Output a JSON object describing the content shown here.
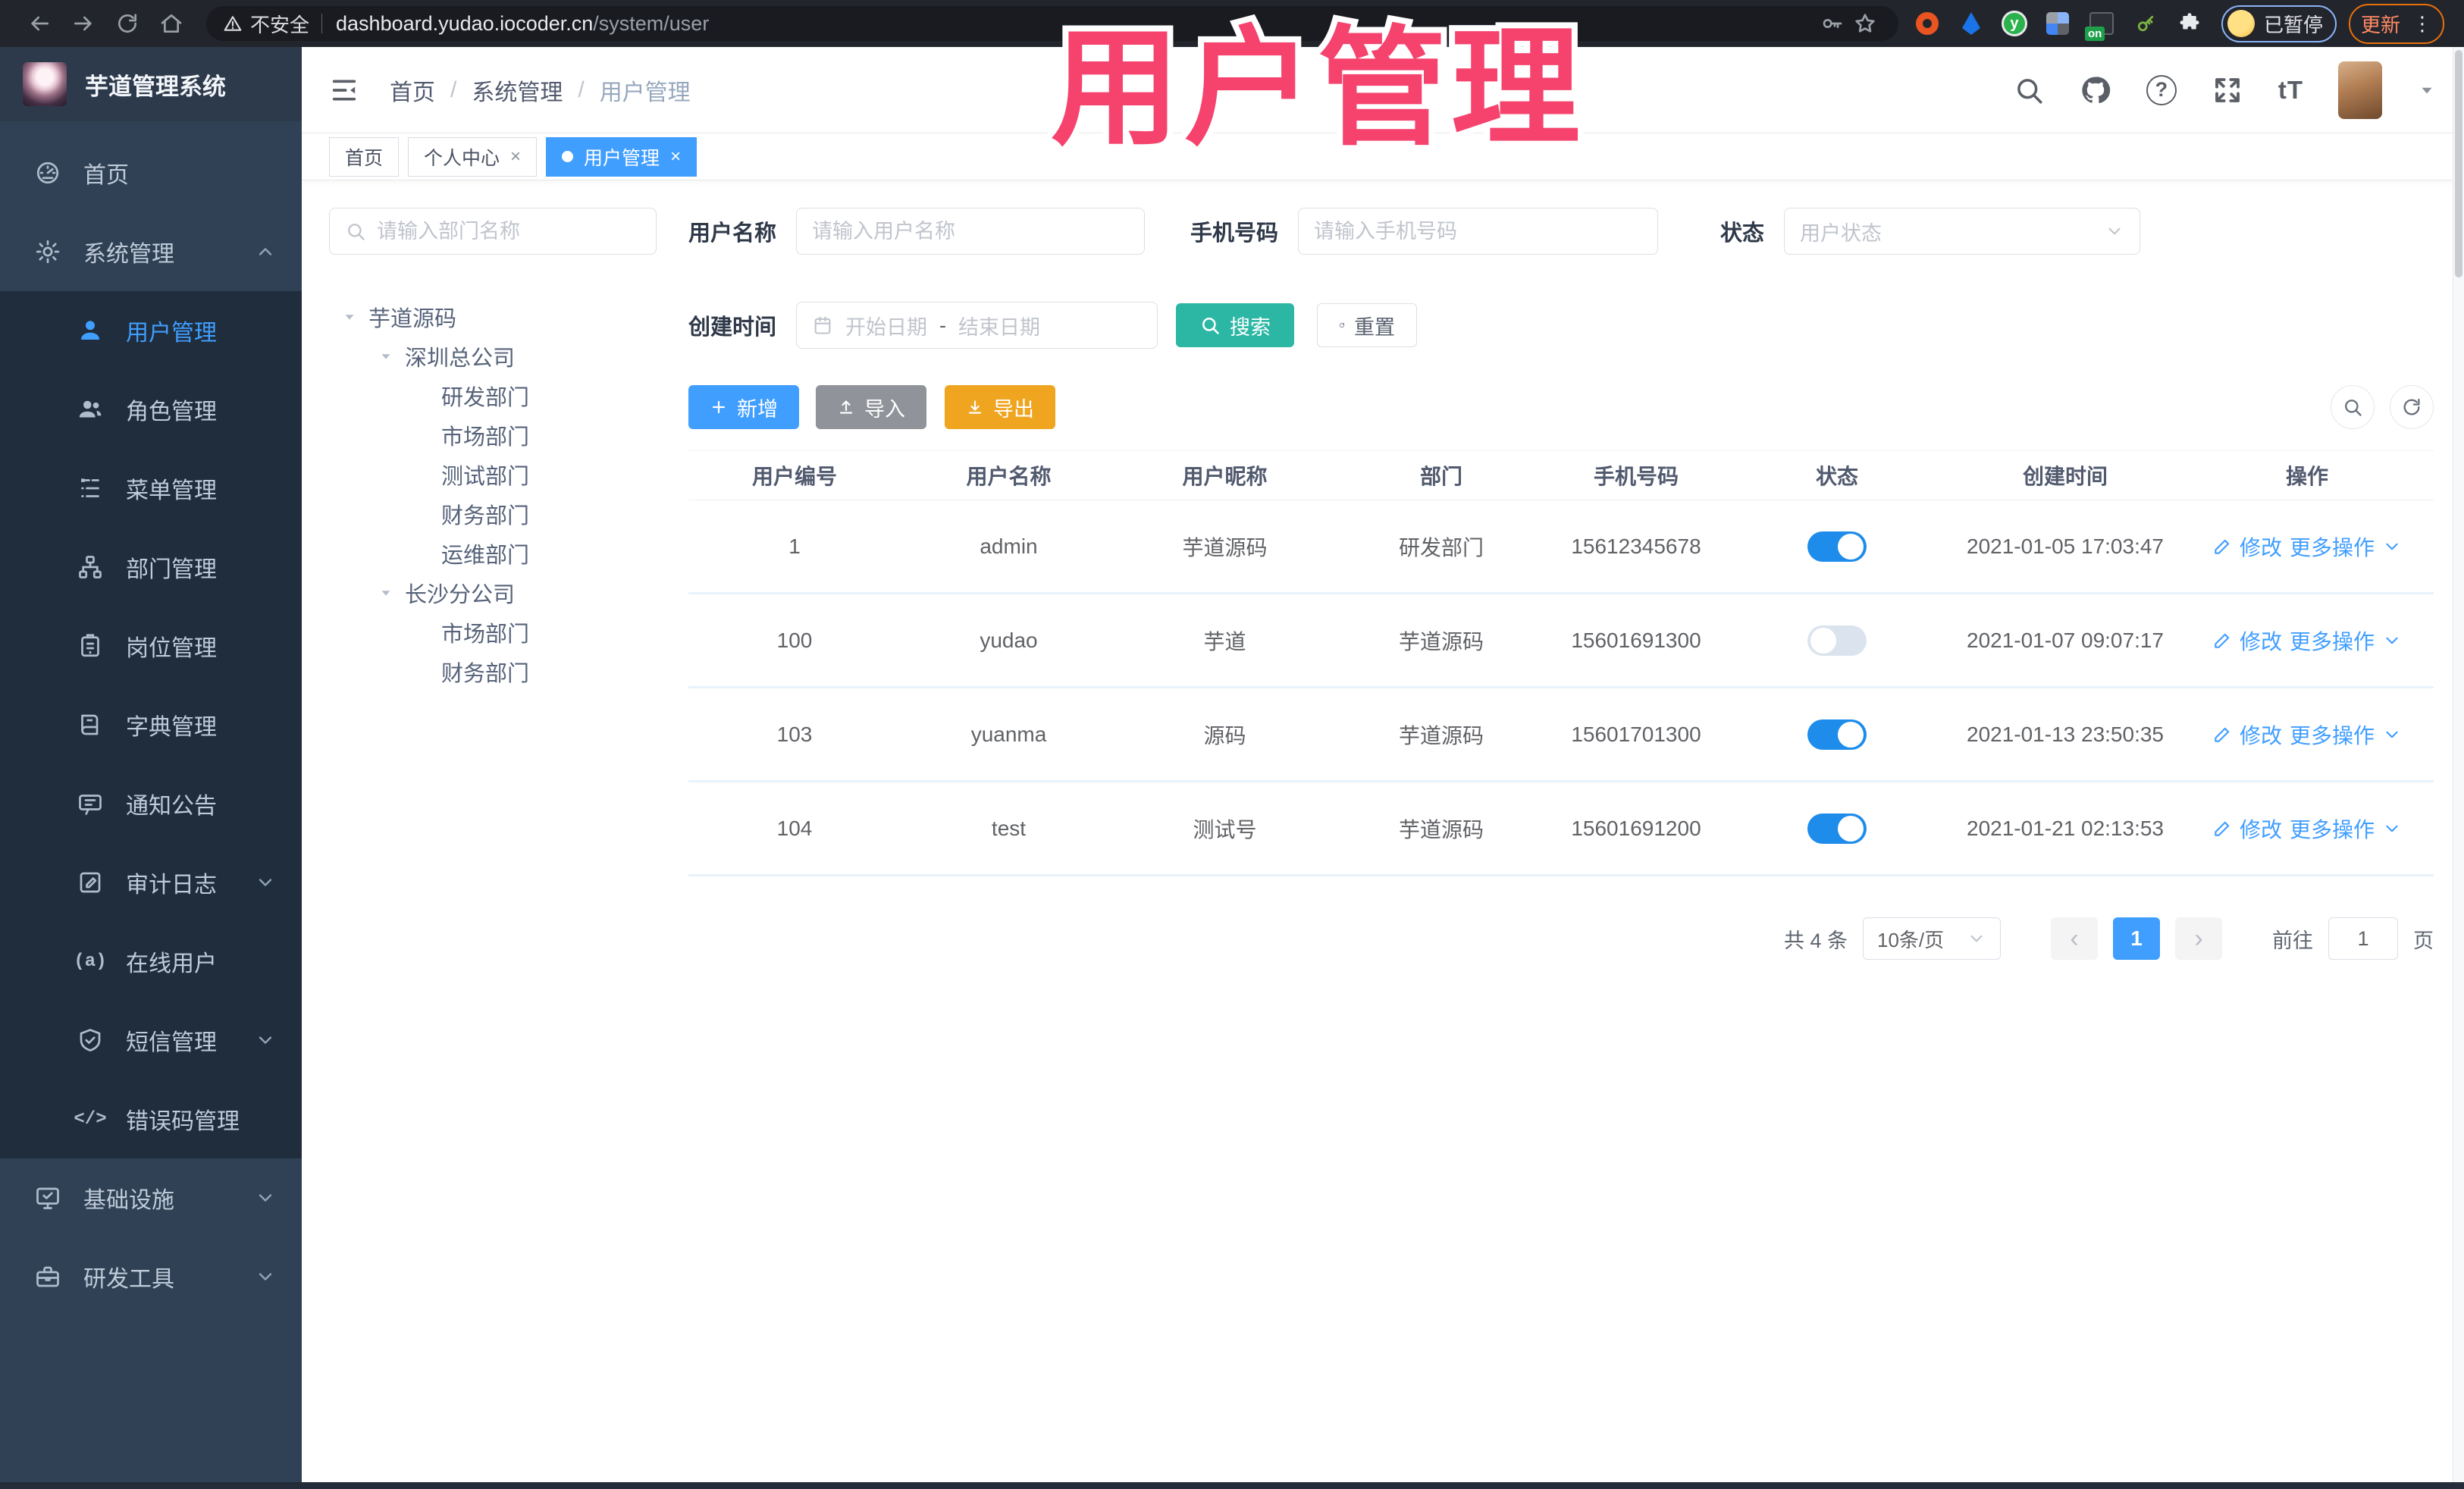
{
  "overlay": {
    "title": "用户管理"
  },
  "colors": {
    "primary": "#409eff",
    "search_teal": "#2cb7a4",
    "export_orange": "#efa51f",
    "import_gray": "#909399",
    "sidebar_bg": "#304156",
    "submenu_bg": "#1f2d3d",
    "overlay_pink": "#f5436d"
  },
  "icons": {
    "slash": "/",
    "close": "×",
    "prev": "‹",
    "next": "›",
    "question": "?",
    "font_size": "tT",
    "online": "(a)",
    "code": "</>",
    "ellipsis": "⋮",
    "y_badge": "y",
    "on_badge": "on"
  },
  "browser": {
    "security_label": "不安全",
    "url_host": "dashboard.yudao.iocoder.cn",
    "url_path": "/system/user",
    "paused_label": "已暂停",
    "update_label": "更新"
  },
  "sidebar": {
    "app_title": "芋道管理系统",
    "items": [
      {
        "label": "首页"
      },
      {
        "label": "系统管理"
      },
      {
        "label": "用户管理"
      },
      {
        "label": "角色管理"
      },
      {
        "label": "菜单管理"
      },
      {
        "label": "部门管理"
      },
      {
        "label": "岗位管理"
      },
      {
        "label": "字典管理"
      },
      {
        "label": "通知公告"
      },
      {
        "label": "审计日志"
      },
      {
        "label": "在线用户"
      },
      {
        "label": "短信管理"
      },
      {
        "label": "错误码管理"
      },
      {
        "label": "基础设施"
      },
      {
        "label": "研发工具"
      }
    ]
  },
  "breadcrumb": {
    "items": [
      "首页",
      "系统管理",
      "用户管理"
    ]
  },
  "tabs": [
    {
      "label": "首页"
    },
    {
      "label": "个人中心"
    },
    {
      "label": "用户管理"
    }
  ],
  "dept": {
    "search_placeholder": "请输入部门名称",
    "tree": [
      {
        "label": "芋道源码"
      },
      {
        "label": "深圳总公司"
      },
      {
        "label": "研发部门"
      },
      {
        "label": "市场部门"
      },
      {
        "label": "测试部门"
      },
      {
        "label": "财务部门"
      },
      {
        "label": "运维部门"
      },
      {
        "label": "长沙分公司"
      },
      {
        "label": "市场部门"
      },
      {
        "label": "财务部门"
      }
    ]
  },
  "filters": {
    "username_label": "用户名称",
    "username_placeholder": "请输入用户名称",
    "mobile_label": "手机号码",
    "mobile_placeholder": "请输入手机号码",
    "status_label": "状态",
    "status_placeholder": "用户状态",
    "created_label": "创建时间",
    "date_start_placeholder": "开始日期",
    "date_separator": "-",
    "date_end_placeholder": "结束日期",
    "search_button": "搜索",
    "reset_button": "重置"
  },
  "actions": {
    "add": "新增",
    "import": "导入",
    "export": "导出"
  },
  "table": {
    "columns": [
      "用户编号",
      "用户名称",
      "用户昵称",
      "部门",
      "手机号码",
      "状态",
      "创建时间",
      "操作"
    ],
    "edit_label": "修改",
    "more_label": "更多操作",
    "rows": [
      {
        "id": "1",
        "username": "admin",
        "nickname": "芋道源码",
        "dept": "研发部门",
        "mobile": "15612345678",
        "status_on": true,
        "created": "2021-01-05 17:03:47"
      },
      {
        "id": "100",
        "username": "yudao",
        "nickname": "芋道",
        "dept": "芋道源码",
        "mobile": "15601691300",
        "status_on": false,
        "created": "2021-01-07 09:07:17"
      },
      {
        "id": "103",
        "username": "yuanma",
        "nickname": "源码",
        "dept": "芋道源码",
        "mobile": "15601701300",
        "status_on": true,
        "created": "2021-01-13 23:50:35"
      },
      {
        "id": "104",
        "username": "test",
        "nickname": "测试号",
        "dept": "芋道源码",
        "mobile": "15601691200",
        "status_on": true,
        "created": "2021-01-21 02:13:53"
      }
    ]
  },
  "pagination": {
    "total": "共 4 条",
    "page_size": "10条/页",
    "current_page": "1",
    "goto_label": "前往",
    "goto_value": "1",
    "page_label": "页"
  }
}
